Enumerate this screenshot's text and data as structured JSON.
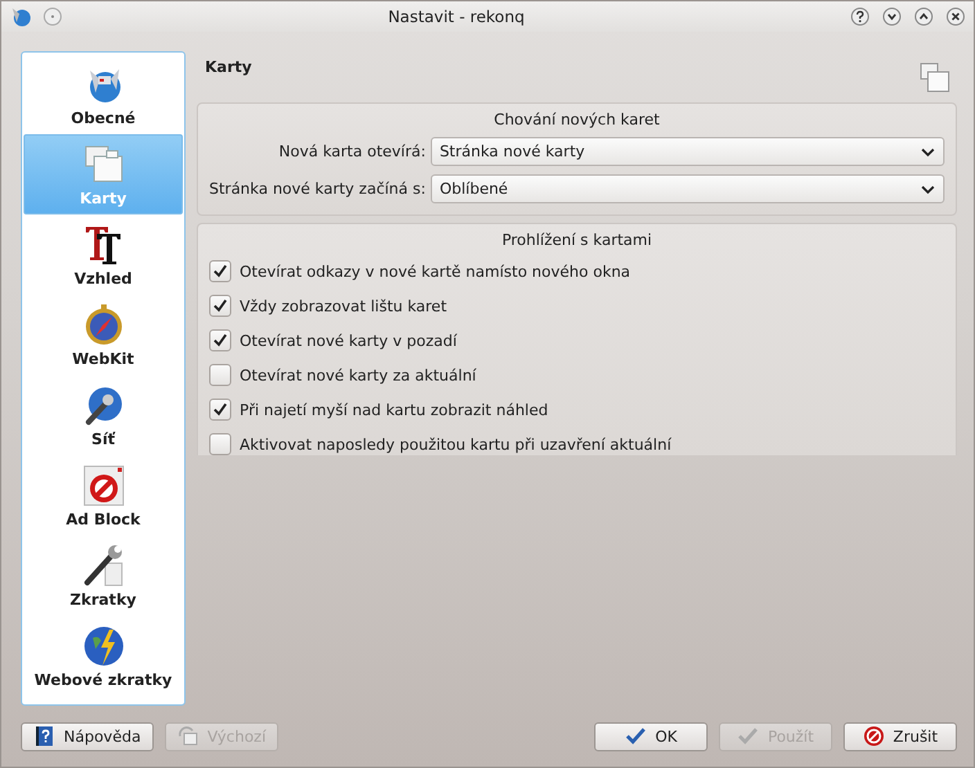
{
  "window": {
    "title": "Nastavit - rekonq"
  },
  "sidebar": {
    "items": [
      {
        "label": "Obecné",
        "kind": "general",
        "selected": false
      },
      {
        "label": "Karty",
        "kind": "tabs",
        "selected": true
      },
      {
        "label": "Vzhled",
        "kind": "font",
        "selected": false
      },
      {
        "label": "WebKit",
        "kind": "compass",
        "selected": false
      },
      {
        "label": "Síť",
        "kind": "network",
        "selected": false
      },
      {
        "label": "Ad Block",
        "kind": "block",
        "selected": false
      },
      {
        "label": "Zkratky",
        "kind": "wrench",
        "selected": false
      },
      {
        "label": "Webové zkratky",
        "kind": "globe",
        "selected": false
      }
    ]
  },
  "page": {
    "title": "Karty"
  },
  "groups": [
    {
      "title": "Chování nových karet",
      "kind": "form",
      "rows": [
        {
          "label": "Nová karta otevírá:",
          "value": "Stránka nové karty"
        },
        {
          "label": "Stránka nové karty začíná s:",
          "value": "Oblíbené"
        }
      ]
    },
    {
      "title": "Prohlížení s kartami",
      "kind": "checks",
      "rows": [
        {
          "label": "Otevírat odkazy v nové kartě namísto nového okna",
          "checked": true
        },
        {
          "label": "Vždy zobrazovat lištu karet",
          "checked": true
        },
        {
          "label": "Otevírat nové karty v pozadí",
          "checked": true
        },
        {
          "label": "Otevírat nové karty za aktuální",
          "checked": false
        },
        {
          "label": "Při najetí myší nad kartu zobrazit náhled",
          "checked": true
        },
        {
          "label": "Aktivovat naposledy použitou kartu při uzavření aktuální",
          "checked": false
        }
      ]
    }
  ],
  "buttons": [
    {
      "label": "Nápověda",
      "kind": "help",
      "disabled": false
    },
    {
      "label": "Výchozí",
      "kind": "defaults",
      "disabled": true
    },
    {
      "label": "OK",
      "kind": "ok",
      "disabled": false
    },
    {
      "label": "Použít",
      "kind": "apply",
      "disabled": true
    },
    {
      "label": "Zrušit",
      "kind": "cancel",
      "disabled": false
    }
  ]
}
